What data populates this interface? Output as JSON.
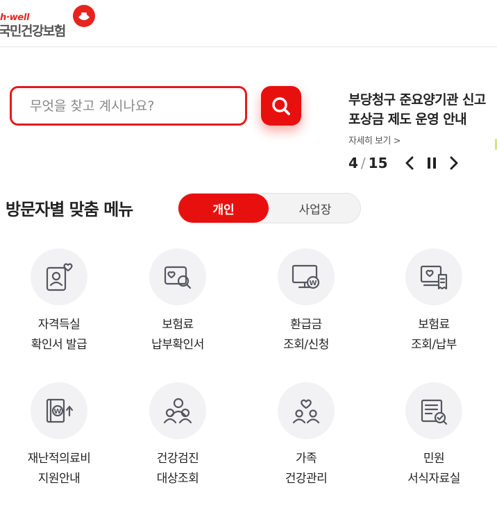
{
  "header": {
    "logo_en": "h·well",
    "logo_ko": "국민건강보험"
  },
  "search": {
    "placeholder": "무엇을 찾고 계시나요?"
  },
  "notice": {
    "title_line1": "부당청구 준요양기관 신고",
    "title_line2": "포상금 제도 운영 안내",
    "more_label": "자세히 보기 >",
    "current": "4",
    "separator": "/",
    "total": "15"
  },
  "section": {
    "title": "방문자별 맞춤 메뉴",
    "toggle_personal": "개인",
    "toggle_business": "사업장"
  },
  "menu": [
    {
      "line1": "자격득실",
      "line2": "확인서 발급",
      "icon": "certificate-person-icon"
    },
    {
      "line1": "보험료",
      "line2": "납부확인서",
      "icon": "document-search-icon"
    },
    {
      "line1": "환급금",
      "line2": "조회/신청",
      "icon": "monitor-won-icon"
    },
    {
      "line1": "보험료",
      "line2": "조회/납부",
      "icon": "computer-receipt-icon"
    },
    {
      "line1": "재난적의료비",
      "line2": "지원안내",
      "icon": "book-won-icon"
    },
    {
      "line1": "건강검진",
      "line2": "대상조회",
      "icon": "people-search-icon"
    },
    {
      "line1": "가족",
      "line2": "건강관리",
      "icon": "family-heart-icon"
    },
    {
      "line1": "민원",
      "line2": "서식자료실",
      "icon": "form-check-icon"
    }
  ],
  "colors": {
    "brand_red": "#e8100e",
    "icon_stroke": "#555560",
    "icon_bg": "#f2f2f4"
  }
}
